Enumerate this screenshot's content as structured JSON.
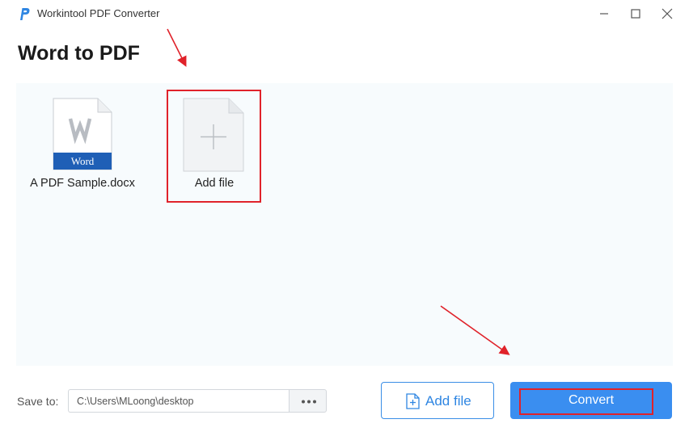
{
  "window": {
    "app_title": "Workintool PDF Converter",
    "controls": [
      "minimize-icon",
      "maximize-icon",
      "close-icon"
    ]
  },
  "page": {
    "title": "Word to PDF"
  },
  "files": [
    {
      "name": "A PDF Sample.docx",
      "icon": "word-doc-icon",
      "badge": "Word"
    }
  ],
  "add_tile": {
    "label": "Add file",
    "icon": "plus-icon"
  },
  "save": {
    "label": "Save to:",
    "path": "C:\\Users\\MLoong\\desktop",
    "browse_icon": "ellipsis-icon"
  },
  "actions": {
    "add_file_label": "Add file",
    "add_file_icon": "file-plus-icon",
    "convert_label": "Convert"
  },
  "colors": {
    "accent": "#3a8ef0",
    "annotation": "#e0222a",
    "word_blue": "#1f5fb6",
    "area_bg": "#f7fbfd"
  }
}
